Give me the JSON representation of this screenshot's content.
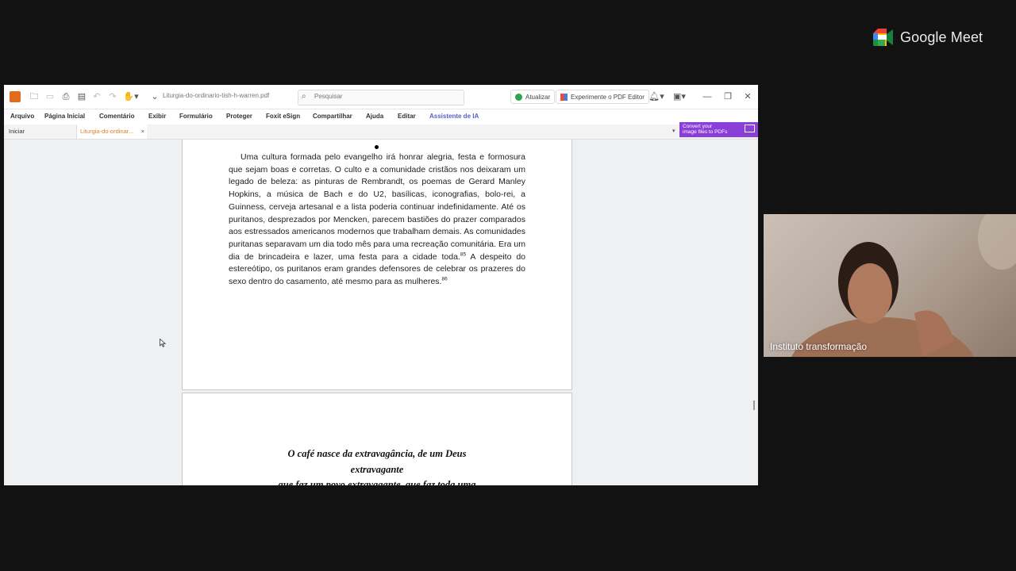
{
  "meet": {
    "brand": "Google Meet",
    "participant_name": "Instituto transformação"
  },
  "app": {
    "file_name": "Liturgia-do-ordinario-tish-h-warren.pdf",
    "search_placeholder": "Pesquisar",
    "update_label": "Atualizar",
    "try_editor_label": "Experimente o PDF Editor",
    "menu": [
      "Arquivo",
      "Página Inicial",
      "Comentário",
      "Exibir",
      "Formulário",
      "Proteger",
      "Foxit eSign",
      "Compartilhar",
      "Ajuda",
      "Editar",
      "Assistente de IA"
    ],
    "tabs": {
      "home": "Iniciar",
      "document": "Liturgia-do-ordinar...",
      "close": "×"
    },
    "convert_banner": {
      "line1": "Convert your",
      "line2": "image files to PDFs"
    }
  },
  "document": {
    "paragraph_before_85": "Uma cultura formada pelo evangelho irá honrar alegria, festa e formosura que sejam boas e corretas. O culto e a comunidade cristãos nos deixaram um legado de beleza: as pinturas de Rembrandt, os poemas de Gerard Manley Hopkins, a música de Bach e do U2, basílicas, iconografias, bolo-rei, a Guinness, cerveja artesanal e a lista poderia continuar indefinidamente. Até os puritanos, desprezados por Mencken, parecem bastiões do prazer comparados aos estressados americanos modernos que trabalham demais. As comunidades puritanas separavam um dia todo mês para uma recreação comunitária. Era um dia de brincadeira e lazer, uma festa para a cidade toda.",
    "footnote_85": "85",
    "paragraph_before_86": " A despeito do estereótipo, os puritanos eram grandes defensores de celebrar os prazeres do sexo dentro do casamento, até mesmo para as mulheres.",
    "footnote_86": "86",
    "quote_line1": "O café nasce da extravagância, de um Deus",
    "quote_line2": "extravagante",
    "quote_line3": "que faz um povo extravagante, que faz toda uma"
  },
  "colors": {
    "accent_purple": "#5b5fc7",
    "tab_orange": "#d9822b",
    "banner_purple": "#8b3fd9"
  }
}
